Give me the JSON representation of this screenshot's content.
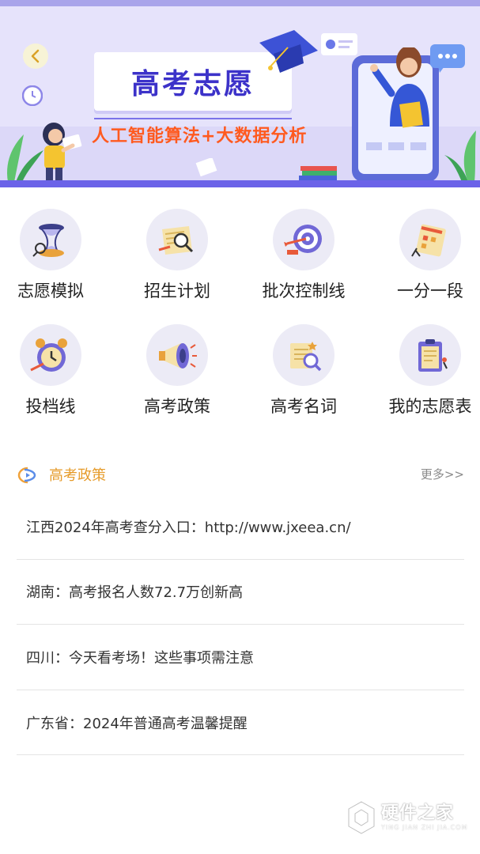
{
  "banner": {
    "title": "高考志愿",
    "subtitle": "人工智能算法+大数据分析",
    "back_icon": "chevron-left-icon"
  },
  "grid": {
    "items": [
      {
        "label": "志愿模拟",
        "icon": "hourglass-icon"
      },
      {
        "label": "招生计划",
        "icon": "scroll-magnifier-icon"
      },
      {
        "label": "批次控制线",
        "icon": "target-icon"
      },
      {
        "label": "一分一段",
        "icon": "calendar-icon"
      },
      {
        "label": "投档线",
        "icon": "alarm-clock-icon"
      },
      {
        "label": "高考政策",
        "icon": "megaphone-icon"
      },
      {
        "label": "高考名词",
        "icon": "document-search-icon"
      },
      {
        "label": "我的志愿表",
        "icon": "clipboard-icon"
      }
    ]
  },
  "policy_section": {
    "title": "高考政策",
    "more_label": "更多>>",
    "news": [
      {
        "text": "江西2024年高考查分入口：http://www.jxeea.cn/"
      },
      {
        "text": "湖南：高考报名人数72.7万创新高"
      },
      {
        "text": "四川：今天看考场！这些事项需注意"
      },
      {
        "text": "广东省：2024年普通高考温馨提醒"
      }
    ]
  },
  "watermark": {
    "text": "硬件之家",
    "sub": "YING JIAN ZHI JIA.COM"
  },
  "colors": {
    "banner_bg": "#e6e3fb",
    "title_blue": "#3c32c9",
    "subtitle_orange": "#ff5a1f",
    "section_title": "#e69b2a",
    "icon_circle_bg": "#ecebf6"
  }
}
